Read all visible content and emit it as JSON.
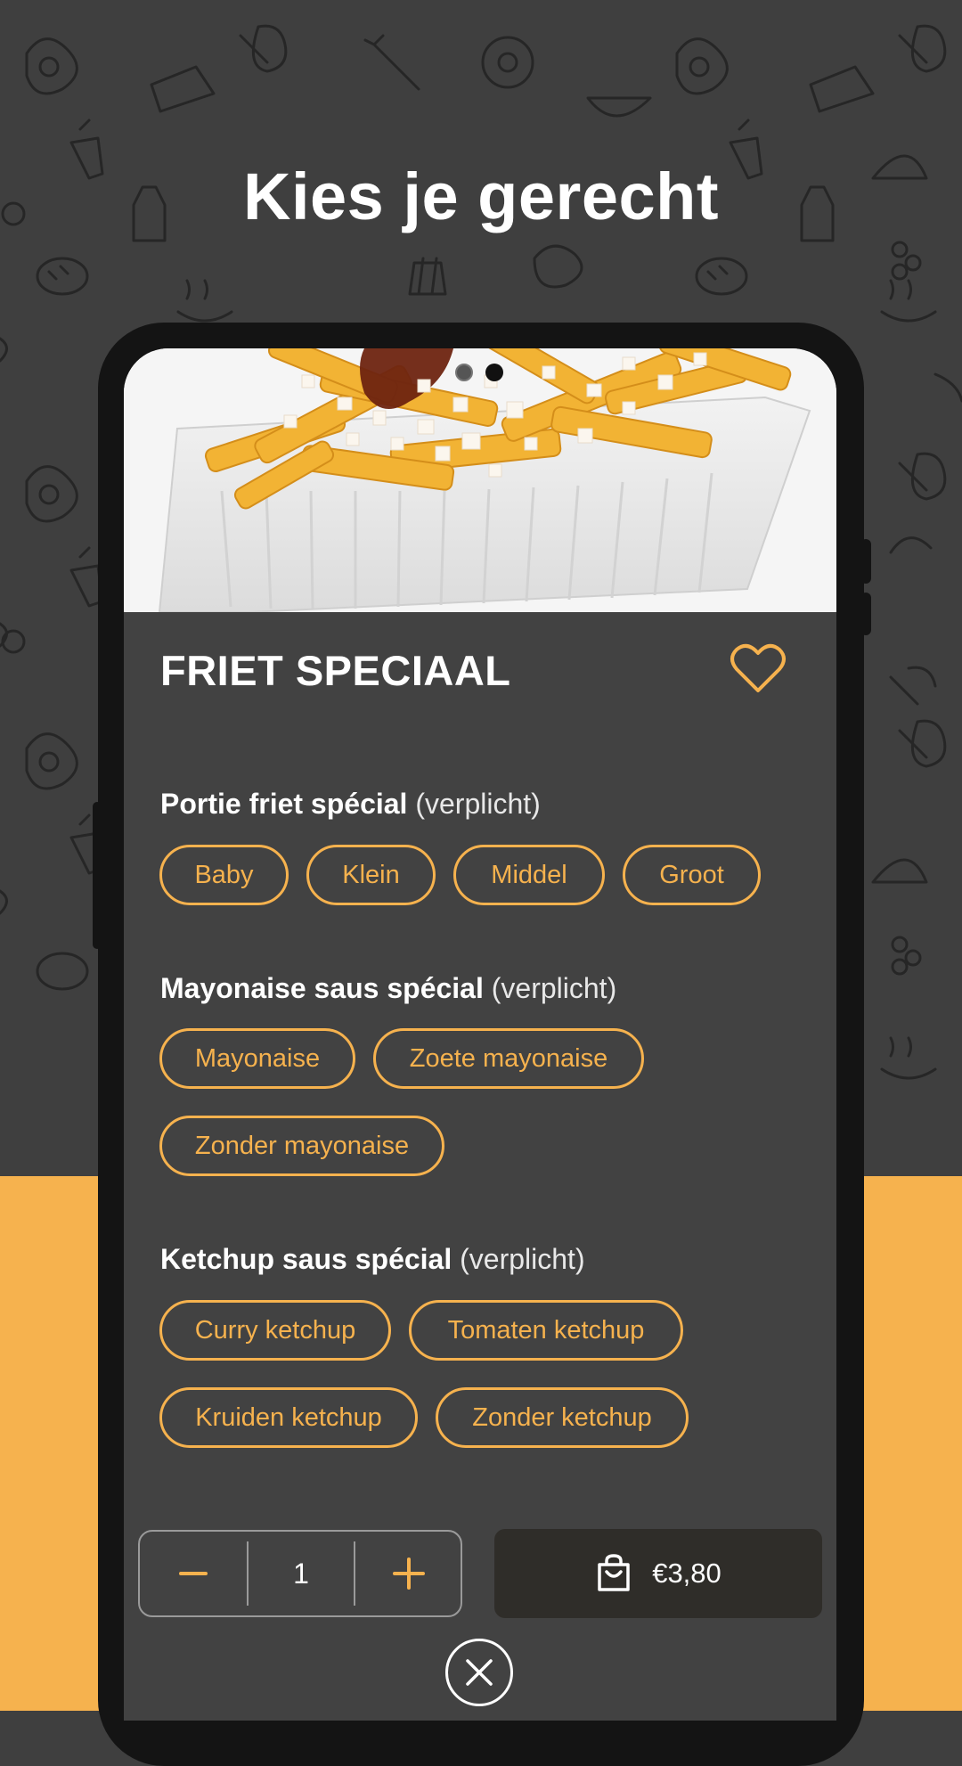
{
  "headline": "Kies je gerecht",
  "carousel": {
    "count": 2,
    "active": 2
  },
  "product": {
    "title": "FRIET SPECIAAL",
    "favorite": false
  },
  "groups": [
    {
      "title": "Portie friet spécial",
      "required": "(verplicht)",
      "options": [
        "Baby",
        "Klein",
        "Middel",
        "Groot"
      ]
    },
    {
      "title": "Mayonaise saus spécial",
      "required": "(verplicht)",
      "options": [
        "Mayonaise",
        "Zoete mayonaise",
        "Zonder mayonaise"
      ]
    },
    {
      "title": "Ketchup saus spécial",
      "required": "(verplicht)",
      "options": [
        "Curry ketchup",
        "Tomaten ketchup",
        "Kruiden ketchup",
        "Zonder ketchup"
      ]
    }
  ],
  "quantity": {
    "value": "1"
  },
  "cart": {
    "price": "€3,80",
    "icon": "shopping-bag-icon"
  },
  "close": {
    "icon": "close-icon"
  },
  "colors": {
    "accent": "#f6b24e",
    "panel": "#424242",
    "background": "#3f3f3f",
    "cart_button": "#2f2d29"
  }
}
